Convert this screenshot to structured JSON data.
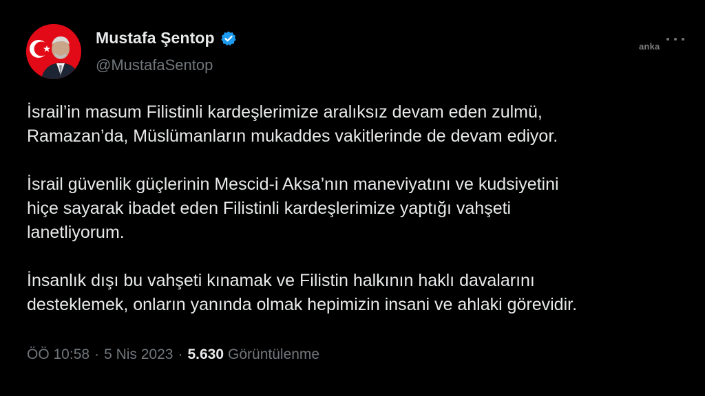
{
  "author": {
    "display_name": "Mustafa Şentop",
    "handle": "@MustafaSentop",
    "verified_icon": "verified-badge-icon",
    "avatar_icon": "profile-avatar-with-flag"
  },
  "more_icon": "more-options-icon",
  "watermark": "anka",
  "tweet": {
    "paragraphs": [
      "İsrail’in masum Filistinli kardeşlerimize aralıksız devam eden zulmü,\nRamazan’da, Müslümanların mukaddes vakitlerinde de devam ediyor.",
      "İsrail güvenlik güçlerinin Mescid-i Aksa’nın maneviyatını ve kudsiyetini\nhiçe sayarak ibadet eden Filistinli kardeşlerimize yaptığı vahşeti\nlanetliyorum.",
      "İnsanlık dışı bu vahşeti kınamak ve Filistin halkının haklı davalarını\ndesteklemek, onların yanında olmak hepimizin insani ve ahlaki görevidir."
    ],
    "time": "ÖÖ 10:58",
    "separator": "·",
    "date": "5 Nis 2023",
    "views_count": "5.630",
    "views_label": "Görüntülenme"
  },
  "colors": {
    "background": "#000000",
    "primary_text": "#e7e9ea",
    "secondary_text": "#71767b",
    "verified_blue": "#1d9bf0",
    "flag_red": "#e30a17"
  }
}
